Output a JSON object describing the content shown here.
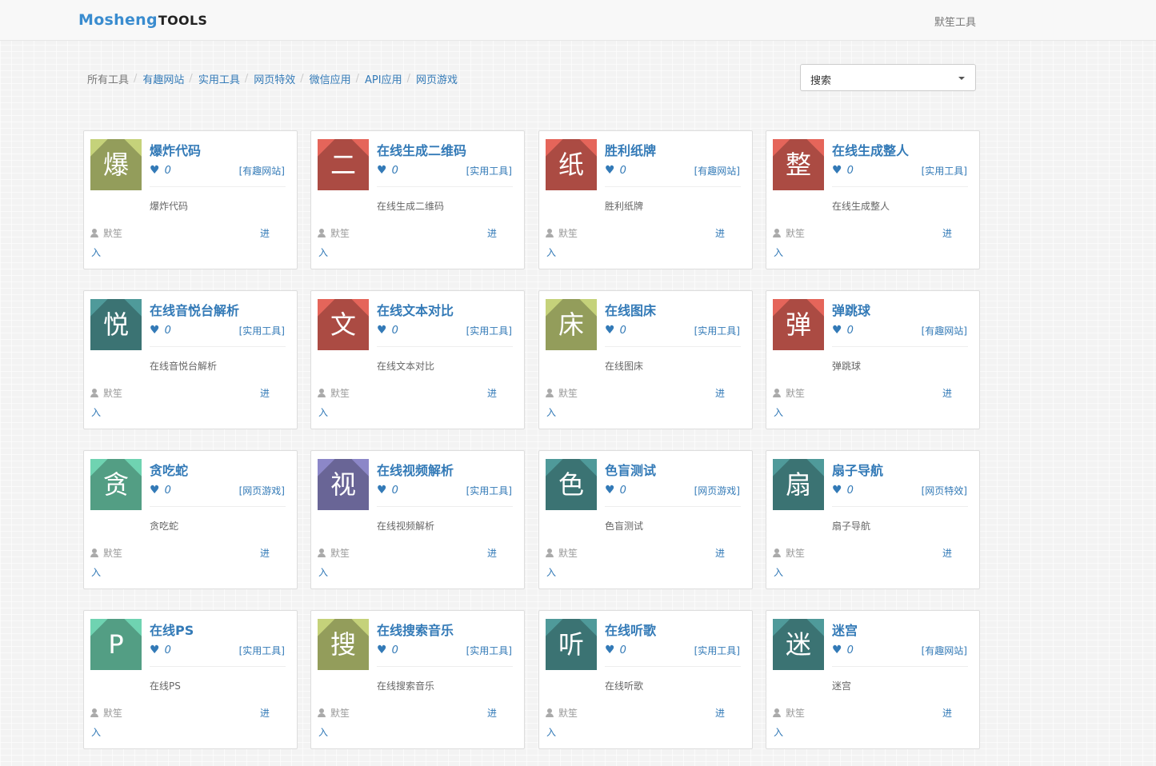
{
  "navbar": {
    "logo_main": "Mosheng",
    "logo_suffix": "TOOLS",
    "right_link": "默笙工具"
  },
  "breadcrumb": {
    "items": [
      {
        "label": "所有工具",
        "active": true
      },
      {
        "label": "有趣网站"
      },
      {
        "label": "实用工具"
      },
      {
        "label": "网页特效"
      },
      {
        "label": "微信应用"
      },
      {
        "label": "API应用"
      },
      {
        "label": "网页游戏"
      }
    ],
    "separator": "/"
  },
  "search": {
    "selected": "搜索"
  },
  "card_common": {
    "author": "默笙",
    "enter_1": "进",
    "enter_2": "入",
    "heart_icon": "heart-icon",
    "user_icon": "user-icon"
  },
  "cards": [
    {
      "char": "爆",
      "title": "爆炸代码",
      "likes": "0",
      "tag": "[有趣网站]",
      "desc": "爆炸代码",
      "color": "#c5d27a"
    },
    {
      "char": "二",
      "title": "在线生成二维码",
      "likes": "0",
      "tag": "[实用工具]",
      "desc": "在线生成二维码",
      "color": "#e5655a"
    },
    {
      "char": "纸",
      "title": "胜利纸牌",
      "likes": "0",
      "tag": "[有趣网站]",
      "desc": "胜利纸牌",
      "color": "#e5655a"
    },
    {
      "char": "整",
      "title": "在线生成整人",
      "likes": "0",
      "tag": "[实用工具]",
      "desc": "在线生成整人",
      "color": "#e5655a"
    },
    {
      "char": "悦",
      "title": "在线音悦台解析",
      "likes": "0",
      "tag": "[实用工具]",
      "desc": "在线音悦台解析",
      "color": "#4f9a9a"
    },
    {
      "char": "文",
      "title": "在线文本对比",
      "likes": "0",
      "tag": "[实用工具]",
      "desc": "在线文本对比",
      "color": "#e5655a"
    },
    {
      "char": "床",
      "title": "在线图床",
      "likes": "0",
      "tag": "[实用工具]",
      "desc": "在线图床",
      "color": "#c5d27a"
    },
    {
      "char": "弹",
      "title": "弹跳球",
      "likes": "0",
      "tag": "[有趣网站]",
      "desc": "弹跳球",
      "color": "#e5655a"
    },
    {
      "char": "贪",
      "title": "贪吃蛇",
      "likes": "0",
      "tag": "[网页游戏]",
      "desc": "贪吃蛇",
      "color": "#6fd3b1"
    },
    {
      "char": "视",
      "title": "在线视频解析",
      "likes": "0",
      "tag": "[实用工具]",
      "desc": "在线视频解析",
      "color": "#8c87c8"
    },
    {
      "char": "色",
      "title": "色盲测试",
      "likes": "0",
      "tag": "[网页游戏]",
      "desc": "色盲测试",
      "color": "#4f9a9a"
    },
    {
      "char": "扇",
      "title": "扇子导航",
      "likes": "0",
      "tag": "[网页特效]",
      "desc": "扇子导航",
      "color": "#4f9a9a"
    },
    {
      "char": "P",
      "title": "在线PS",
      "likes": "0",
      "tag": "[实用工具]",
      "desc": "在线PS",
      "color": "#6fd3b1"
    },
    {
      "char": "搜",
      "title": "在线搜索音乐",
      "likes": "0",
      "tag": "[实用工具]",
      "desc": "在线搜索音乐",
      "color": "#c5d27a"
    },
    {
      "char": "听",
      "title": "在线听歌",
      "likes": "0",
      "tag": "[实用工具]",
      "desc": "在线听歌",
      "color": "#4f9a9a"
    },
    {
      "char": "迷",
      "title": "迷宫",
      "likes": "0",
      "tag": "[有趣网站]",
      "desc": "迷宫",
      "color": "#4f9a9a"
    }
  ]
}
